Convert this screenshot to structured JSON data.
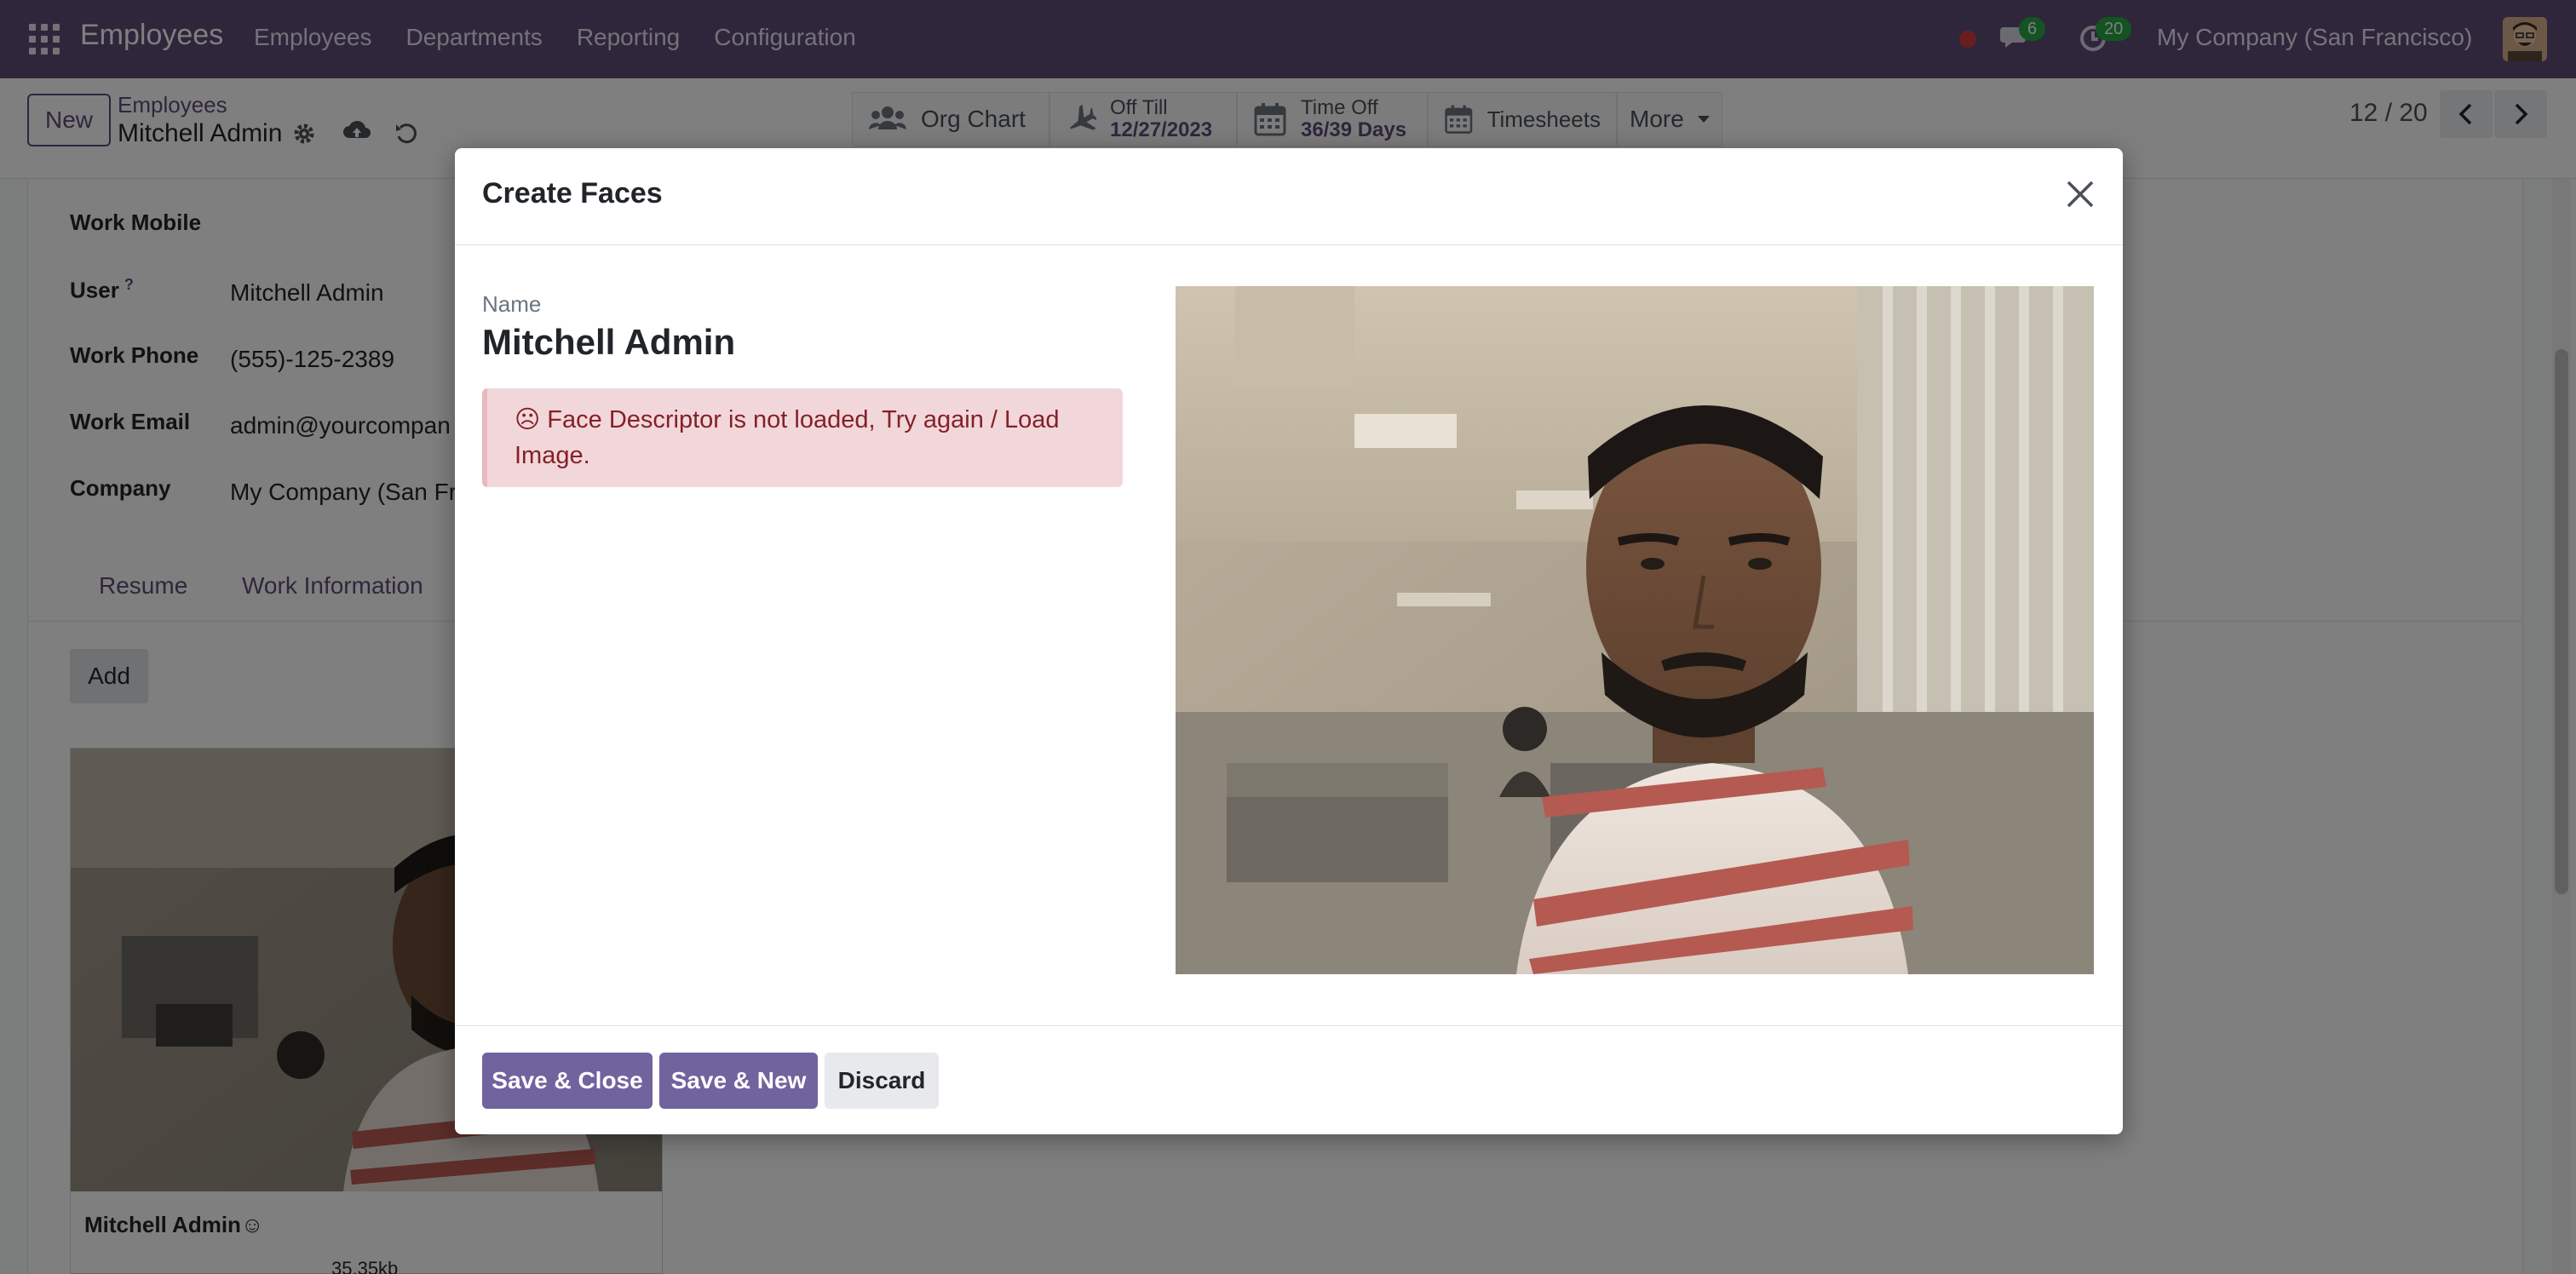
{
  "navbar": {
    "brand": "Employees",
    "menu": [
      "Employees",
      "Departments",
      "Reporting",
      "Configuration"
    ],
    "messages_count": "6",
    "activities_count": "20",
    "company": "My Company (San Francisco)"
  },
  "control": {
    "new_label": "New",
    "breadcrumb_parent": "Employees",
    "breadcrumb_current": "Mitchell Admin",
    "pager": "12 / 20"
  },
  "smart_buttons": {
    "org_chart": "Org Chart",
    "off_till_label": "Off Till",
    "off_till_value": "12/27/2023",
    "time_off_label": "Time Off",
    "time_off_value": "36/39 Days",
    "timesheets": "Timesheets",
    "more": "More"
  },
  "form": {
    "fields": [
      {
        "label": "Work Mobile",
        "value": ""
      },
      {
        "label": "User",
        "value": "Mitchell Admin"
      },
      {
        "label": "Work Phone",
        "value": "(555)-125-2389"
      },
      {
        "label": "Work Email",
        "value": "admin@yourcompan"
      },
      {
        "label": "Company",
        "value": "My Company (San Fr"
      }
    ],
    "user_help": "?",
    "tabs": [
      "Resume",
      "Work Information"
    ],
    "add_label": "Add",
    "card_name": "Mitchell Admin☺",
    "card_size": "35.35kb"
  },
  "modal": {
    "title": "Create Faces",
    "name_label": "Name",
    "name_value": "Mitchell Admin",
    "alert_text": "☹ Face Descriptor is not loaded, Try again / Load Image.",
    "buttons": {
      "save_close": "Save & Close",
      "save_new": "Save & New",
      "discard": "Discard"
    }
  },
  "colors": {
    "brand": "#5e4c79",
    "primary_button": "#71639e",
    "alert_bg": "#f2d7da",
    "alert_text": "#842029"
  }
}
